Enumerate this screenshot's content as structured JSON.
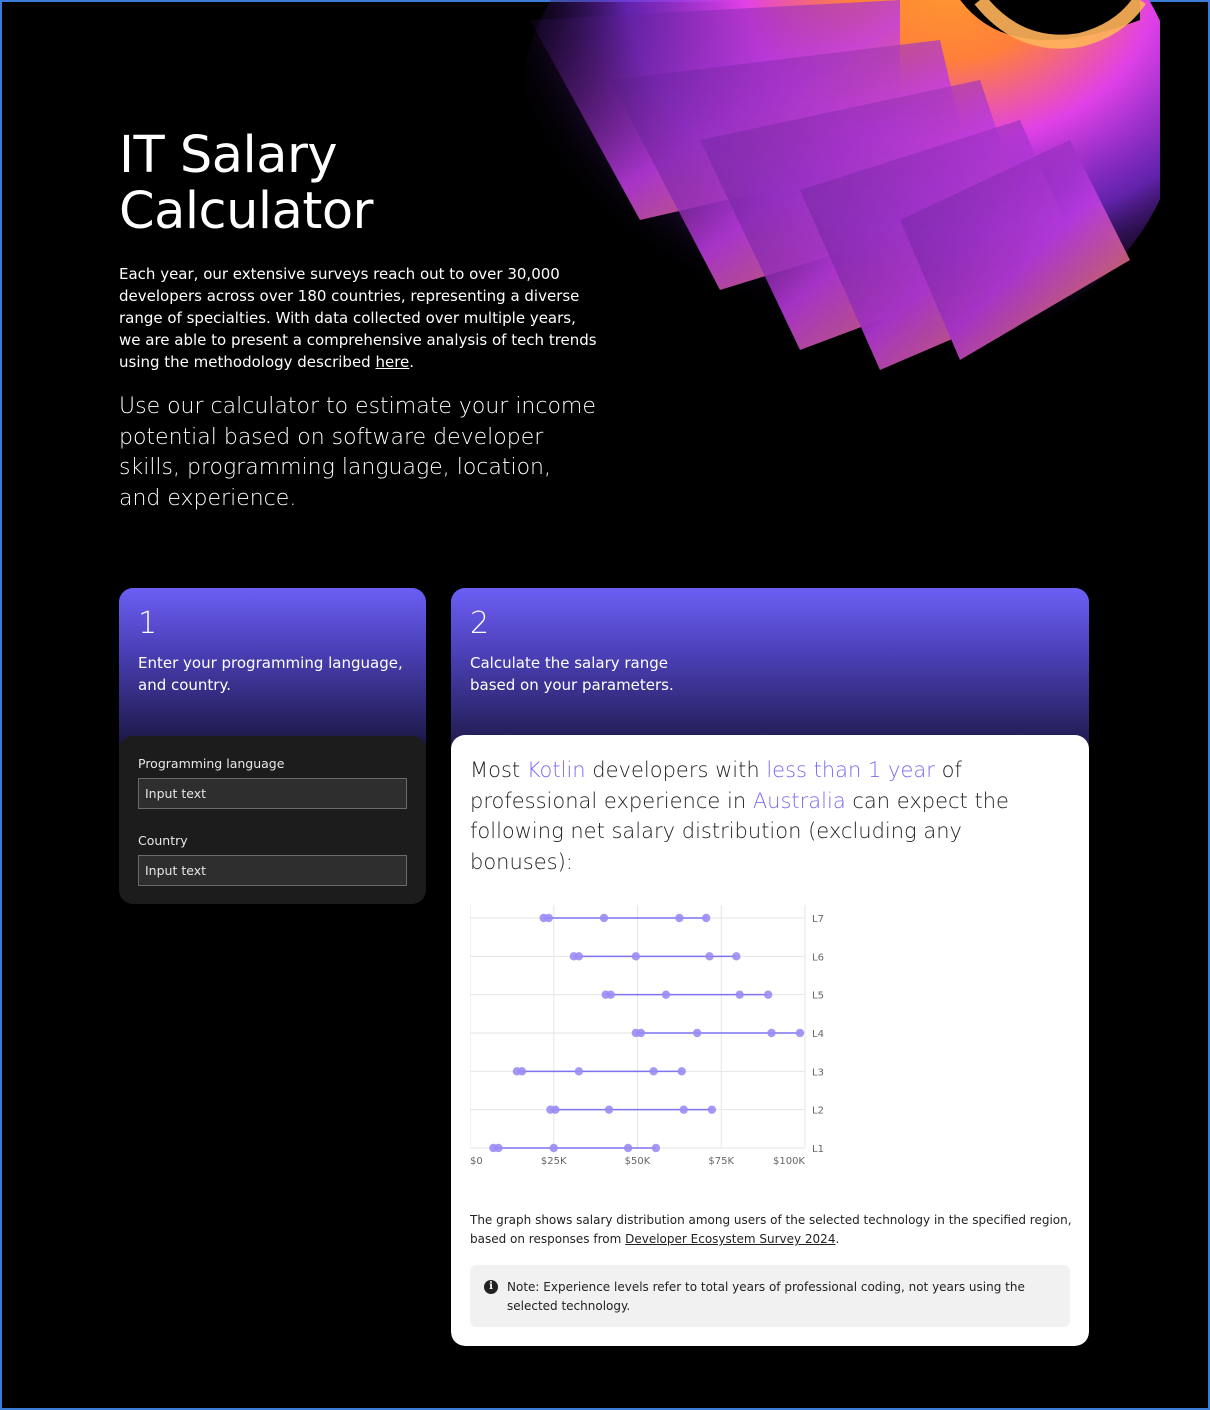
{
  "hero": {
    "title_line1": "IT Salary",
    "title_line2": "Calculator",
    "intro_text": "Each year, our extensive surveys reach out to over 30,000 developers across over 180 countries, representing a diverse range of specialties. With data collected over multiple years, we are able to present a comprehensive analysis of tech trends using the methodology described ",
    "intro_link": "here",
    "intro_end": ".",
    "lead": "Use our calculator to estimate your income potential based on software developer skills, programming language, location, and experience."
  },
  "step1": {
    "number": "1",
    "text": "Enter your programming language, and country.",
    "language_label": "Programming language",
    "language_placeholder": "Input text",
    "country_label": "Country",
    "country_placeholder": "Input text"
  },
  "step2": {
    "number": "2",
    "text_line1": "Calculate the salary range",
    "text_line2": "based on your parameters.",
    "result": {
      "p1": "Most ",
      "language": "Kotlin",
      "p2": " developers with ",
      "experience": "less than 1 year",
      "p3": " of professional experience in ",
      "country": "Australia",
      "p4": " can expect the following net salary distribution (excluding any bonuses):"
    },
    "caption_text": "The graph shows salary distribution among users of the selected technology in the specified region, based on responses from ",
    "caption_link": "Developer Ecosystem Survey 2024",
    "caption_end": ".",
    "note": "Note: Experience levels refer to total years of professional coding, not years using the selected technology."
  },
  "colors": {
    "accent": "#7a6cf2",
    "dot": "#9a8cf5",
    "line": "#7f72ee",
    "grid": "#e6e6e6"
  },
  "chart_data": {
    "type": "dot-range",
    "x_ticks": [
      "$0",
      "$25K",
      "$50K",
      "$75K",
      "$100K"
    ],
    "xlim": [
      0,
      100000
    ],
    "levels": [
      {
        "label": "L7",
        "values": [
          22000,
          23500,
          40000,
          62500,
          70500
        ]
      },
      {
        "label": "L6",
        "values": [
          31000,
          32500,
          49500,
          71500,
          79500
        ]
      },
      {
        "label": "L5",
        "values": [
          40500,
          42000,
          58500,
          80500,
          89000
        ]
      },
      {
        "label": "L4",
        "values": [
          49500,
          51000,
          67800,
          90000,
          98500
        ]
      },
      {
        "label": "L3",
        "values": [
          14000,
          15500,
          32500,
          54800,
          63200
        ]
      },
      {
        "label": "L2",
        "values": [
          24000,
          25500,
          41500,
          63800,
          72200
        ]
      },
      {
        "label": "L1",
        "values": [
          7000,
          8500,
          25000,
          47200,
          55500
        ]
      }
    ]
  }
}
